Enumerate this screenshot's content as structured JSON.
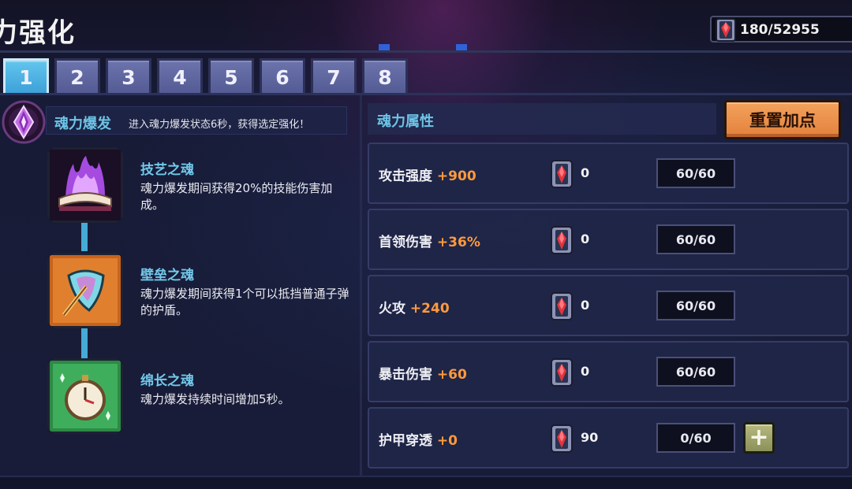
{
  "header": {
    "title": "力强化",
    "currency_icon": "soul-gem-icon",
    "currency_value": "180/52955"
  },
  "tabs": [
    {
      "label": "1",
      "active": true
    },
    {
      "label": "2",
      "active": false
    },
    {
      "label": "3",
      "active": false
    },
    {
      "label": "4",
      "active": false
    },
    {
      "label": "5",
      "active": false
    },
    {
      "label": "6",
      "active": false
    },
    {
      "label": "7",
      "active": false
    },
    {
      "label": "8",
      "active": false
    }
  ],
  "burst": {
    "icon": "soul-crystal-icon",
    "name": "魂力爆发",
    "desc": "进入魂力爆发状态6秒，获得选定强化！"
  },
  "souls": [
    {
      "name": "技艺之魂",
      "desc": "魂力爆发期间获得20%的技能伤害加成。",
      "icon": "purple-flame-book-icon"
    },
    {
      "name": "壁垒之魂",
      "desc": "魂力爆发期间获得1个可以抵挡普通子弹的护盾。",
      "icon": "shield-icon"
    },
    {
      "name": "绵长之魂",
      "desc": "魂力爆发持续时间增加5秒。",
      "icon": "stopwatch-icon"
    }
  ],
  "attributes": {
    "title": "魂力属性",
    "reset_label": "重置加点",
    "rows": [
      {
        "label": "攻击强度",
        "bonus": "+900",
        "cost": "0",
        "level": "60/60",
        "plus": false
      },
      {
        "label": "首领伤害",
        "bonus": "+36%",
        "cost": "0",
        "level": "60/60",
        "plus": false
      },
      {
        "label": "火攻",
        "bonus": "+240",
        "cost": "0",
        "level": "60/60",
        "plus": false
      },
      {
        "label": "暴击伤害",
        "bonus": "+60",
        "cost": "0",
        "level": "60/60",
        "plus": false
      },
      {
        "label": "护甲穿透",
        "bonus": "+0",
        "cost": "90",
        "level": "0/60",
        "plus": true
      }
    ],
    "plus_symbol": "+"
  },
  "colors": {
    "accent_blue": "#6cc4e6",
    "bonus_orange": "#ff9a3c",
    "reset_orange": "#e88a44",
    "active_tab": "#4fb3e4"
  }
}
